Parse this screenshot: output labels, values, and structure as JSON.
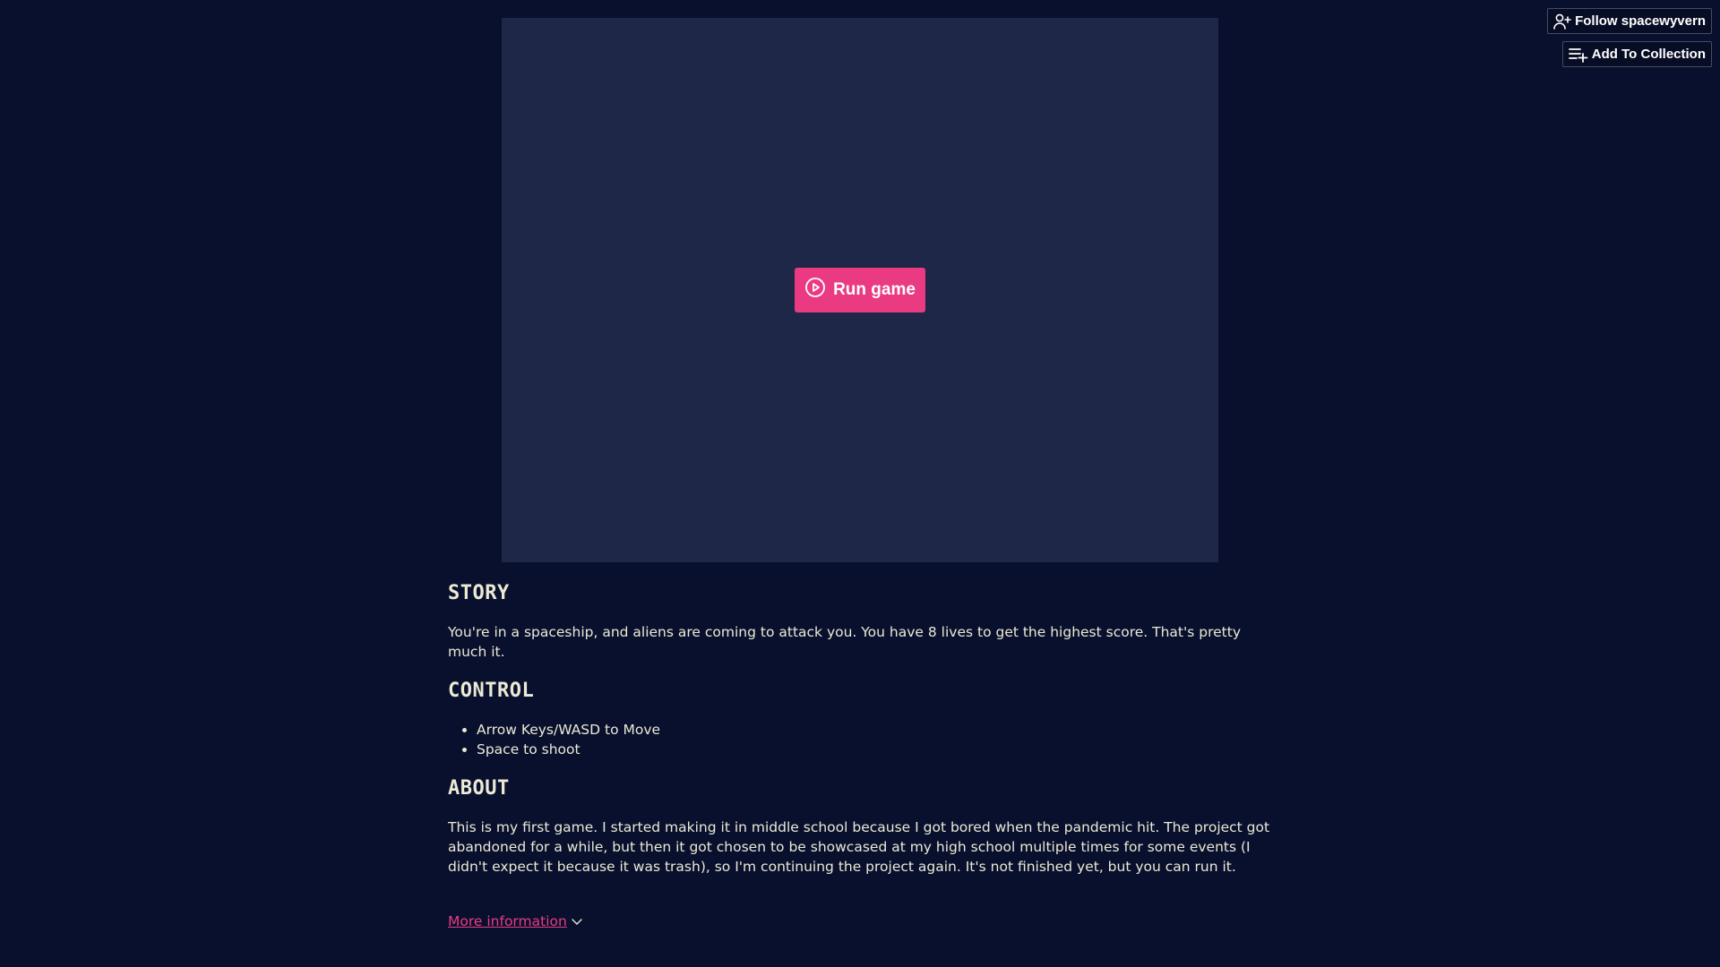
{
  "header": {
    "follow_label": "Follow spacewyvern",
    "collection_label": "Add To Collection"
  },
  "game": {
    "run_label": "Run game"
  },
  "sections": {
    "story": {
      "heading": "STORY",
      "text": "You're in a spaceship, and aliens are coming to attack you. You have 8 lives to get the highest score. That's pretty much it."
    },
    "control": {
      "heading": "CONTROL",
      "items": [
        "Arrow Keys/WASD to Move",
        "Space to shoot"
      ]
    },
    "about": {
      "heading": "ABOUT",
      "text": "This is my first game. I started making it in middle school because I got bored when the pandemic hit. The project got abandoned for a while, but then it got chosen to be showcased at my high school multiple times for some events (I didn't expect it because it was trash), so I'm continuing the project again. It's not finished yet, but you can run it."
    }
  },
  "footer": {
    "more_info_label": "More information"
  },
  "colors": {
    "background": "#08102e",
    "game_frame": "#1e2747",
    "accent": "#ea3b82",
    "text": "#ece9d4"
  },
  "icons": {
    "follow": "user-plus-icon",
    "collection": "playlist-add-icon",
    "run": "play-circle-icon",
    "more_info": "chevron-down-icon"
  }
}
